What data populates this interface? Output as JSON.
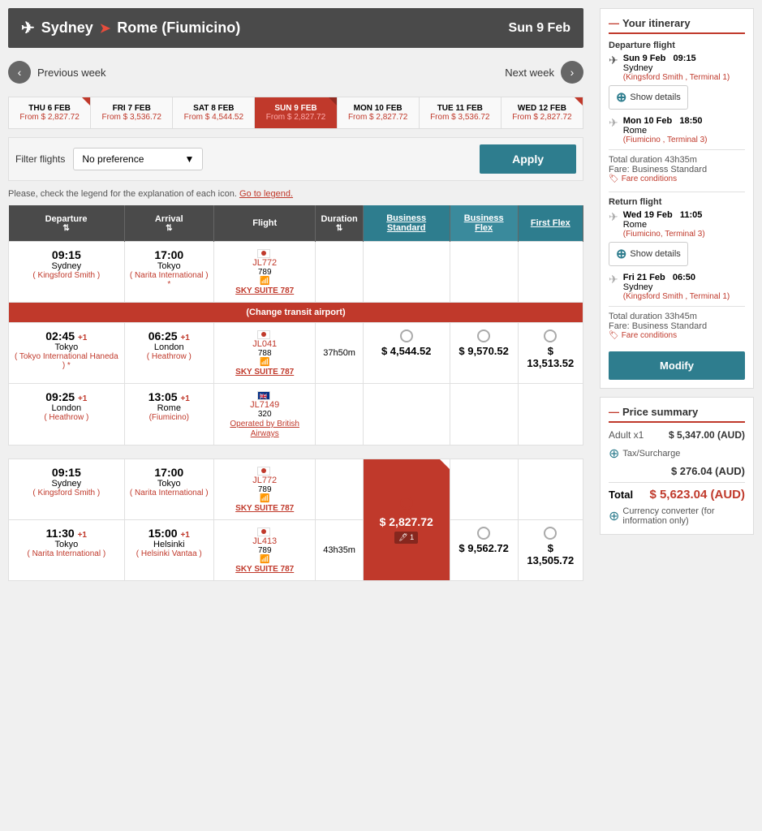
{
  "route": {
    "origin": "Sydney",
    "destination": "Rome (Fiumicino)",
    "date": "Sun 9 Feb",
    "plane_icon": "✈"
  },
  "week_nav": {
    "prev_label": "Previous week",
    "next_label": "Next week"
  },
  "dates": [
    {
      "day": "THU",
      "num": "6",
      "month": "FEB",
      "price": "From $ 2,827.72",
      "selected": false,
      "flag": true
    },
    {
      "day": "FRI",
      "num": "7",
      "month": "FEB",
      "price": "From $ 3,536.72",
      "selected": false,
      "flag": false
    },
    {
      "day": "SAT",
      "num": "8",
      "month": "FEB",
      "price": "From $ 4,544.52",
      "selected": false,
      "flag": false
    },
    {
      "day": "SUN",
      "num": "9",
      "month": "FEB",
      "price": "From $ 2,827.72",
      "selected": true,
      "flag": true
    },
    {
      "day": "MON",
      "num": "10",
      "month": "FEB",
      "price": "From $ 2,827.72",
      "selected": false,
      "flag": false
    },
    {
      "day": "TUE",
      "num": "11",
      "month": "FEB",
      "price": "From $ 3,536.72",
      "selected": false,
      "flag": false
    },
    {
      "day": "WED",
      "num": "12",
      "month": "FEB",
      "price": "From $ 2,827.72",
      "selected": false,
      "flag": true
    }
  ],
  "filter": {
    "label": "Filter flights",
    "value": "No preference",
    "apply_label": "Apply"
  },
  "legend_note": "Please, check the legend for the explanation of each icon.",
  "legend_link": "Go to legend.",
  "table": {
    "headers": {
      "departure": "Departure",
      "arrival": "Arrival",
      "flight": "Flight",
      "duration": "Duration",
      "business_standard": "Business Standard",
      "business_flex": "Business Flex",
      "first_flex": "First Flex"
    },
    "rows": [
      {
        "group": 1,
        "segments": [
          {
            "departure_time": "09:15",
            "departure_city": "Sydney",
            "departure_airport": "( Kingsford Smith )",
            "arrival_time": "17:00",
            "arrival_city": "Tokyo",
            "arrival_airport": "( Narita International )*",
            "flight_num": "JL772",
            "aircraft": "789",
            "wifi": true,
            "suite": "SKY SUITE 787",
            "flag": "japan",
            "plus_day_dep": null,
            "plus_day_arr": null
          }
        ],
        "transit": "(Change transit airport)",
        "segments2": [
          {
            "departure_time": "02:45",
            "departure_plus": "+1",
            "departure_city": "Tokyo",
            "departure_airport": "( Tokyo International Haneda )*",
            "arrival_time": "06:25",
            "arrival_plus": "+1",
            "arrival_city": "London",
            "arrival_airport": "( Heathrow )",
            "flight_num": "JL041",
            "aircraft": "788",
            "wifi": true,
            "suite": "SKY SUITE 787",
            "flag": "japan",
            "duration": "37h50m",
            "price_bs": "$ 4,544.52",
            "price_bf": "$ 9,570.52",
            "price_ff": "$ 13,513.52",
            "selected": false
          },
          {
            "departure_time": "09:25",
            "departure_plus": "+1",
            "departure_city": "London",
            "departure_airport": "( Heathrow )",
            "arrival_time": "13:05",
            "arrival_plus": "+1",
            "arrival_city": "Rome",
            "arrival_airport": "(Fiumicino)",
            "flight_num": "JL7149",
            "aircraft": "320",
            "wifi": false,
            "suite": null,
            "flag": "japan",
            "operated_by": "Operated by British Airways",
            "duration": null,
            "price_bs": null,
            "price_bf": null,
            "price_ff": null
          }
        ]
      },
      {
        "group": 2,
        "segments": [
          {
            "departure_time": "09:15",
            "departure_city": "Sydney",
            "departure_airport": "( Kingsford Smith )",
            "arrival_time": "17:00",
            "arrival_city": "Tokyo",
            "arrival_airport": "( Narita International )",
            "flight_num": "JL772",
            "aircraft": "789",
            "wifi": true,
            "suite": "SKY SUITE 787",
            "flag": "japan",
            "duration": null,
            "price_bs": null,
            "price_bf": null,
            "price_ff": null
          },
          {
            "departure_time": "11:30",
            "departure_plus": "+1",
            "departure_city": "Tokyo",
            "departure_airport": "( Narita International )",
            "arrival_time": "15:00",
            "arrival_plus": "+1",
            "arrival_city": "Helsinki",
            "arrival_airport": "( Helsinki Vantaa )",
            "flight_num": "JL413",
            "aircraft": "789",
            "wifi": true,
            "suite": "SKY SUITE 787",
            "flag": "japan",
            "duration": "43h35m",
            "price_bs": "$ 2,827.72",
            "price_bf": "$ 9,562.72",
            "price_ff": "$ 13,505.72",
            "selected": true,
            "badge": "1"
          }
        ]
      }
    ]
  },
  "itinerary": {
    "title": "Your itinerary",
    "departure_flight": {
      "label": "Departure flight",
      "segments": [
        {
          "date": "Sun 9 Feb",
          "time": "09:15",
          "city": "Sydney",
          "airport": "(Kingsford Smith , Terminal 1)"
        },
        {
          "date": "Mon 10 Feb",
          "time": "18:50",
          "city": "Rome",
          "airport": "(Fiumicino , Terminal 3)"
        }
      ],
      "show_details": "Show details",
      "total_duration": "Total duration 43h35m",
      "fare": "Fare: Business Standard",
      "fare_conditions": "Fare conditions"
    },
    "return_flight": {
      "label": "Return flight",
      "segments": [
        {
          "date": "Wed 19 Feb",
          "time": "11:05",
          "city": "Rome",
          "airport": "(Fiumicino, Terminal 3)"
        },
        {
          "date": "Fri 21 Feb",
          "time": "06:50",
          "city": "Sydney",
          "airport": "(Kingsford Smith , Terminal 1)"
        }
      ],
      "show_details": "Show details",
      "total_duration": "Total duration 33h45m",
      "fare": "Fare: Business Standard",
      "fare_conditions": "Fare conditions"
    },
    "modify_label": "Modify"
  },
  "price_summary": {
    "title": "Price summary",
    "adult": "Adult x1",
    "adult_price": "$ 5,347.00 (AUD)",
    "tax_label": "Tax/Surcharge",
    "tax_price": "$ 276.04 (AUD)",
    "total_label": "Total",
    "total_price": "$ 5,623.04 (AUD)",
    "currency_converter": "Currency converter (for information only)"
  }
}
